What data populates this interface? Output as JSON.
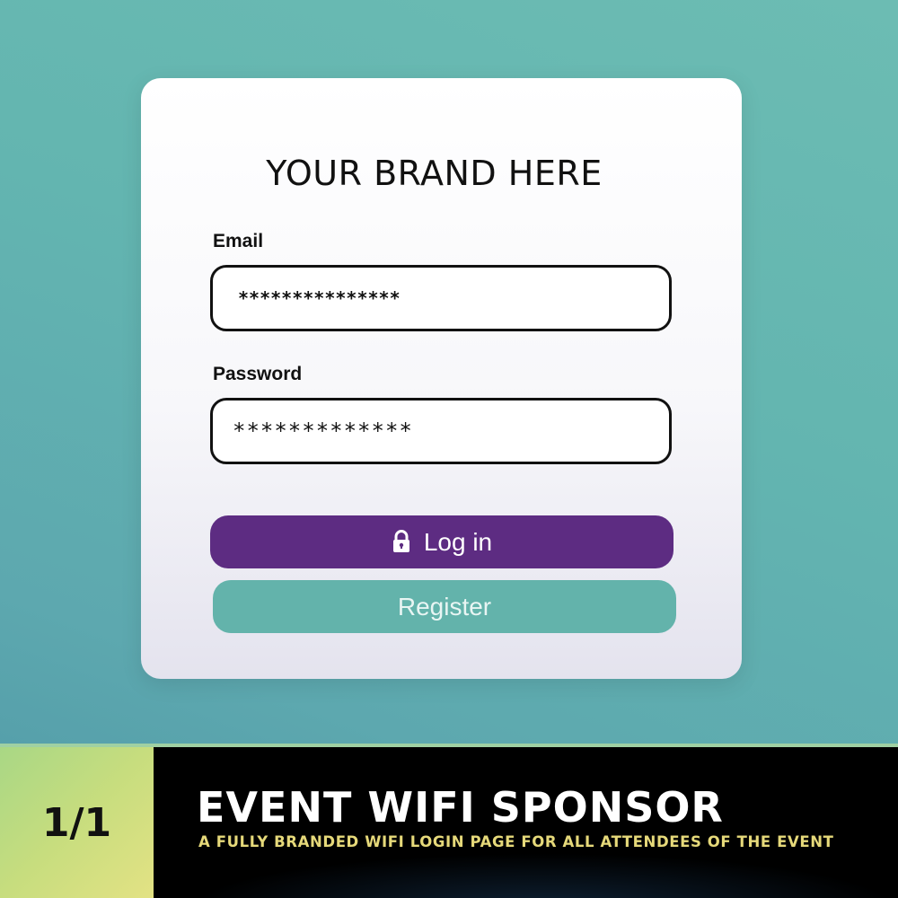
{
  "card": {
    "brand": "YOUR BRAND HERE",
    "email_label": "Email",
    "email_value": "***************",
    "password_label": "Password",
    "password_value": "*************",
    "login_button": "Log in",
    "login_icon": "lock-icon",
    "register_button": "Register"
  },
  "banner": {
    "counter": "1/1",
    "title": "EVENT WIFI SPONSOR",
    "subtitle": "A FULLY BRANDED WIFI LOGIN PAGE FOR ALL ATTENDEES OF THE EVENT"
  },
  "colors": {
    "background": "#63b5b0",
    "login_button": "#5d2c82",
    "register_button": "#63b3ab",
    "banner_background": "#000000",
    "subtitle_text": "#e6d97a",
    "counter_background": "#c7dd7e"
  }
}
